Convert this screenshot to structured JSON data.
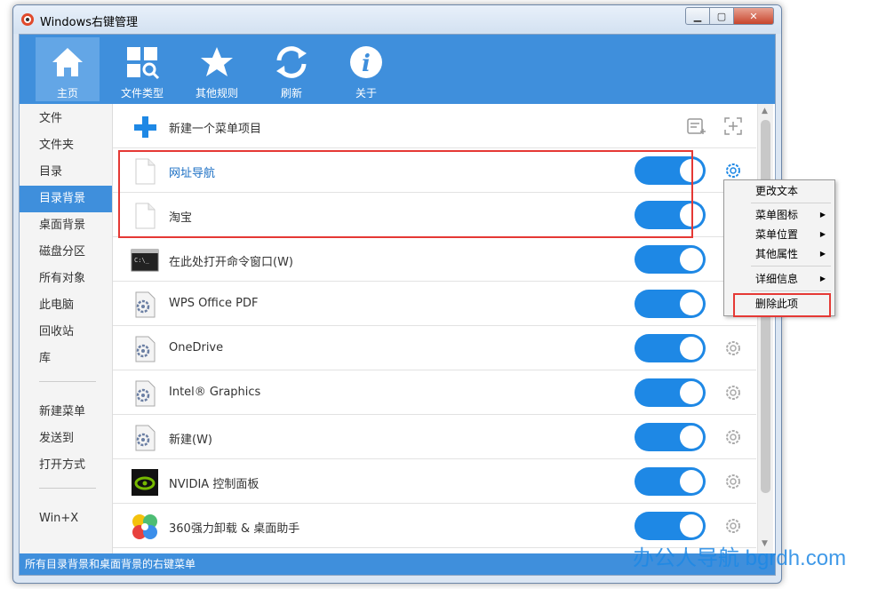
{
  "window": {
    "title": "Windows右键管理"
  },
  "toolbar": {
    "items": [
      {
        "label": "主页",
        "icon": "home-icon",
        "active": true
      },
      {
        "label": "文件类型",
        "icon": "file-types-icon"
      },
      {
        "label": "其他规则",
        "icon": "star-icon"
      },
      {
        "label": "刷新",
        "icon": "refresh-icon"
      },
      {
        "label": "关于",
        "icon": "info-icon"
      }
    ]
  },
  "sidebar": {
    "items": [
      {
        "label": "文件"
      },
      {
        "label": "文件夹"
      },
      {
        "label": "目录"
      },
      {
        "label": "目录背景",
        "active": true
      },
      {
        "label": "桌面背景"
      },
      {
        "label": "磁盘分区"
      },
      {
        "label": "所有对象"
      },
      {
        "label": "此电脑"
      },
      {
        "label": "回收站"
      },
      {
        "label": "库"
      },
      {
        "label": "新建菜单"
      },
      {
        "label": "发送到"
      },
      {
        "label": "打开方式"
      },
      {
        "label": "Win+X"
      }
    ]
  },
  "new_item": {
    "label": "新建一个菜单项目"
  },
  "rows": [
    {
      "label": "网址导航",
      "icon": "blank-file-icon",
      "enabled": true,
      "highlighted": true
    },
    {
      "label": "淘宝",
      "icon": "blank-file-icon",
      "enabled": true
    },
    {
      "label": "在此处打开命令窗口(W)",
      "icon": "cmd-icon",
      "enabled": true
    },
    {
      "label": "WPS Office PDF",
      "icon": "settings-file-icon",
      "enabled": true
    },
    {
      "label": "OneDrive",
      "icon": "settings-file-icon",
      "enabled": true
    },
    {
      "label": "Intel® Graphics",
      "icon": "settings-file-icon",
      "enabled": true
    },
    {
      "label": "新建(W)",
      "icon": "settings-file-icon",
      "enabled": true
    },
    {
      "label": "NVIDIA 控制面板",
      "icon": "nvidia-icon",
      "enabled": true
    },
    {
      "label": "360强力卸载 & 桌面助手",
      "icon": "360-icon",
      "enabled": true
    }
  ],
  "context_menu": {
    "items": [
      {
        "label": "更改文本",
        "submenu": false
      },
      {
        "label": "菜单图标",
        "submenu": true
      },
      {
        "label": "菜单位置",
        "submenu": true
      },
      {
        "label": "其他属性",
        "submenu": true
      },
      {
        "label": "详细信息",
        "submenu": true
      },
      {
        "label": "删除此项",
        "submenu": false
      }
    ]
  },
  "status": {
    "text": "所有目录背景和桌面背景的右键菜单"
  },
  "watermark": {
    "text": "办公人导航 bgrdh.com"
  },
  "colors": {
    "accent": "#3f8fdc",
    "toggle_on": "#1e88e5",
    "highlight_box": "#e53935"
  }
}
